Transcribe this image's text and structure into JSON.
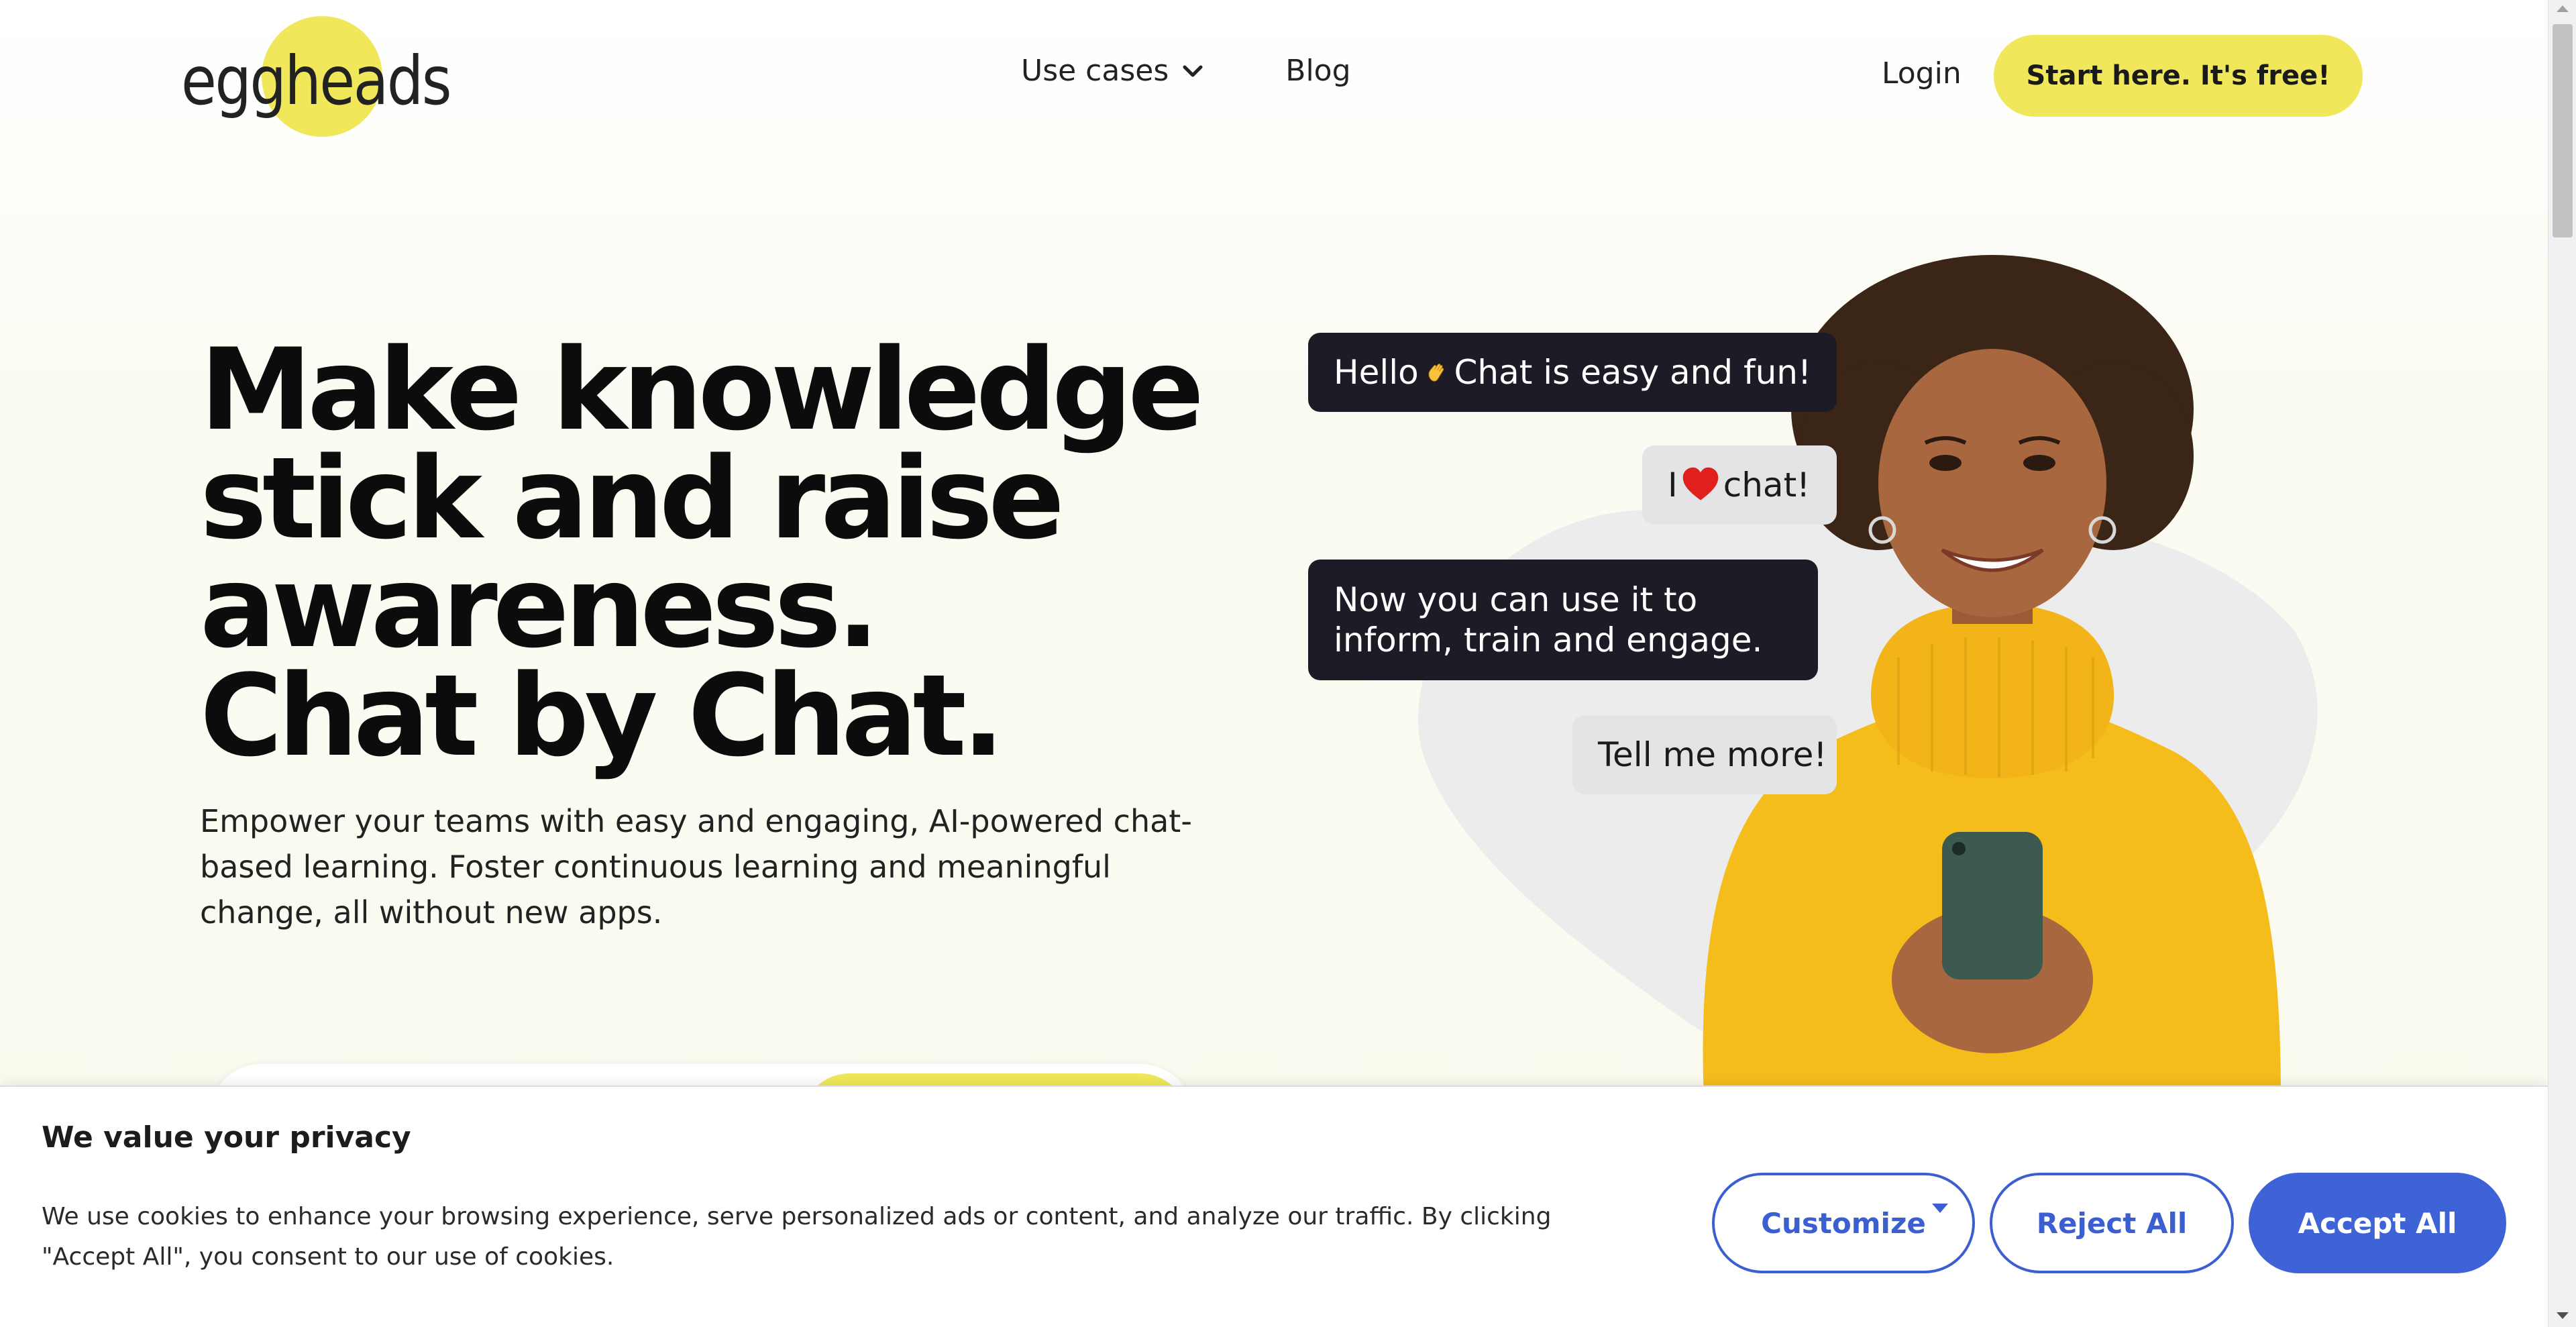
{
  "brand": {
    "name": "eggheads",
    "accent": "#f0e85a"
  },
  "nav": {
    "use_cases": "Use cases",
    "blog": "Blog",
    "login": "Login",
    "cta": "Start here. It's free!"
  },
  "hero": {
    "title_lines": [
      "Make knowledge",
      "stick and raise",
      "awareness.",
      "Chat by Chat."
    ],
    "subtitle": "Empower your teams with easy and engaging, AI-powered chat-based learning. Foster continuous learning and meaningful change, all without new apps."
  },
  "chat": {
    "b1_pre": "Hello",
    "b1_post": "Chat is easy and fun!",
    "b2_pre": "I",
    "b2_post": "chat!",
    "b3": "Now you can use it to inform, train and engage.",
    "b4": "Tell me more!"
  },
  "cookie": {
    "title": "We value your privacy",
    "text": "We use cookies to enhance your browsing experience, serve personalized ads or content, and analyze our traffic. By clicking \"Accept All\", you consent to our use of cookies.",
    "customize": "Customize",
    "reject": "Reject All",
    "accept": "Accept All",
    "button_color": "#3e63d6"
  },
  "icons": [
    "chevron-down-icon",
    "waving-hand-icon",
    "heart-icon",
    "caret-down-icon"
  ]
}
